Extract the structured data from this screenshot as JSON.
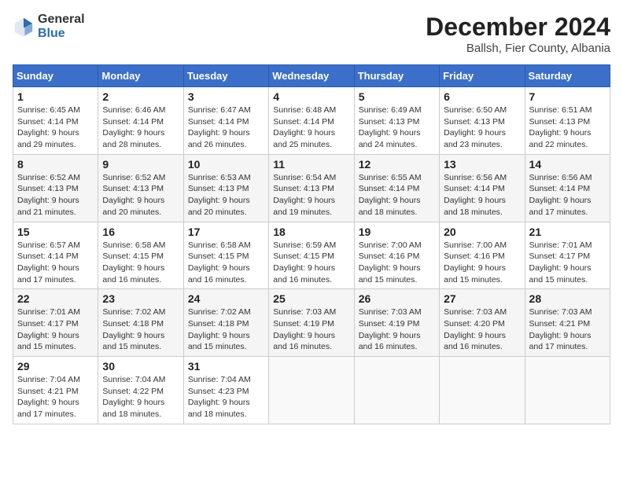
{
  "logo": {
    "general": "General",
    "blue": "Blue"
  },
  "header": {
    "month": "December 2024",
    "location": "Ballsh, Fier County, Albania"
  },
  "weekdays": [
    "Sunday",
    "Monday",
    "Tuesday",
    "Wednesday",
    "Thursday",
    "Friday",
    "Saturday"
  ],
  "weeks": [
    [
      {
        "day": "1",
        "sunrise": "6:45 AM",
        "sunset": "4:14 PM",
        "daylight": "9 hours and 29 minutes."
      },
      {
        "day": "2",
        "sunrise": "6:46 AM",
        "sunset": "4:14 PM",
        "daylight": "9 hours and 28 minutes."
      },
      {
        "day": "3",
        "sunrise": "6:47 AM",
        "sunset": "4:14 PM",
        "daylight": "9 hours and 26 minutes."
      },
      {
        "day": "4",
        "sunrise": "6:48 AM",
        "sunset": "4:14 PM",
        "daylight": "9 hours and 25 minutes."
      },
      {
        "day": "5",
        "sunrise": "6:49 AM",
        "sunset": "4:13 PM",
        "daylight": "9 hours and 24 minutes."
      },
      {
        "day": "6",
        "sunrise": "6:50 AM",
        "sunset": "4:13 PM",
        "daylight": "9 hours and 23 minutes."
      },
      {
        "day": "7",
        "sunrise": "6:51 AM",
        "sunset": "4:13 PM",
        "daylight": "9 hours and 22 minutes."
      }
    ],
    [
      {
        "day": "8",
        "sunrise": "6:52 AM",
        "sunset": "4:13 PM",
        "daylight": "9 hours and 21 minutes."
      },
      {
        "day": "9",
        "sunrise": "6:52 AM",
        "sunset": "4:13 PM",
        "daylight": "9 hours and 20 minutes."
      },
      {
        "day": "10",
        "sunrise": "6:53 AM",
        "sunset": "4:13 PM",
        "daylight": "9 hours and 20 minutes."
      },
      {
        "day": "11",
        "sunrise": "6:54 AM",
        "sunset": "4:13 PM",
        "daylight": "9 hours and 19 minutes."
      },
      {
        "day": "12",
        "sunrise": "6:55 AM",
        "sunset": "4:14 PM",
        "daylight": "9 hours and 18 minutes."
      },
      {
        "day": "13",
        "sunrise": "6:56 AM",
        "sunset": "4:14 PM",
        "daylight": "9 hours and 18 minutes."
      },
      {
        "day": "14",
        "sunrise": "6:56 AM",
        "sunset": "4:14 PM",
        "daylight": "9 hours and 17 minutes."
      }
    ],
    [
      {
        "day": "15",
        "sunrise": "6:57 AM",
        "sunset": "4:14 PM",
        "daylight": "9 hours and 17 minutes."
      },
      {
        "day": "16",
        "sunrise": "6:58 AM",
        "sunset": "4:15 PM",
        "daylight": "9 hours and 16 minutes."
      },
      {
        "day": "17",
        "sunrise": "6:58 AM",
        "sunset": "4:15 PM",
        "daylight": "9 hours and 16 minutes."
      },
      {
        "day": "18",
        "sunrise": "6:59 AM",
        "sunset": "4:15 PM",
        "daylight": "9 hours and 16 minutes."
      },
      {
        "day": "19",
        "sunrise": "7:00 AM",
        "sunset": "4:16 PM",
        "daylight": "9 hours and 15 minutes."
      },
      {
        "day": "20",
        "sunrise": "7:00 AM",
        "sunset": "4:16 PM",
        "daylight": "9 hours and 15 minutes."
      },
      {
        "day": "21",
        "sunrise": "7:01 AM",
        "sunset": "4:17 PM",
        "daylight": "9 hours and 15 minutes."
      }
    ],
    [
      {
        "day": "22",
        "sunrise": "7:01 AM",
        "sunset": "4:17 PM",
        "daylight": "9 hours and 15 minutes."
      },
      {
        "day": "23",
        "sunrise": "7:02 AM",
        "sunset": "4:18 PM",
        "daylight": "9 hours and 15 minutes."
      },
      {
        "day": "24",
        "sunrise": "7:02 AM",
        "sunset": "4:18 PM",
        "daylight": "9 hours and 15 minutes."
      },
      {
        "day": "25",
        "sunrise": "7:03 AM",
        "sunset": "4:19 PM",
        "daylight": "9 hours and 16 minutes."
      },
      {
        "day": "26",
        "sunrise": "7:03 AM",
        "sunset": "4:19 PM",
        "daylight": "9 hours and 16 minutes."
      },
      {
        "day": "27",
        "sunrise": "7:03 AM",
        "sunset": "4:20 PM",
        "daylight": "9 hours and 16 minutes."
      },
      {
        "day": "28",
        "sunrise": "7:03 AM",
        "sunset": "4:21 PM",
        "daylight": "9 hours and 17 minutes."
      }
    ],
    [
      {
        "day": "29",
        "sunrise": "7:04 AM",
        "sunset": "4:21 PM",
        "daylight": "9 hours and 17 minutes."
      },
      {
        "day": "30",
        "sunrise": "7:04 AM",
        "sunset": "4:22 PM",
        "daylight": "9 hours and 18 minutes."
      },
      {
        "day": "31",
        "sunrise": "7:04 AM",
        "sunset": "4:23 PM",
        "daylight": "9 hours and 18 minutes."
      },
      null,
      null,
      null,
      null
    ]
  ]
}
